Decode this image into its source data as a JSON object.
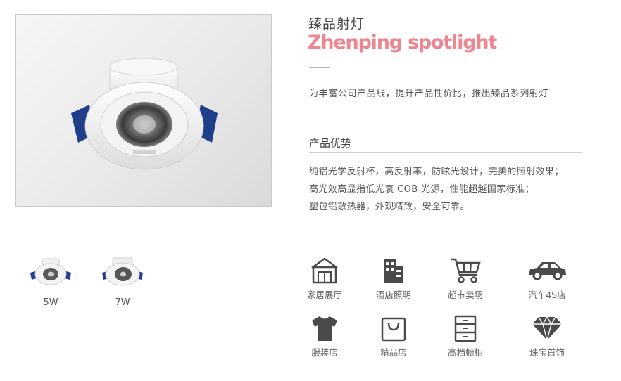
{
  "product": {
    "title_cn": "臻品射灯",
    "title_en": "Zhenping spotlight",
    "intro": "为丰富公司产品线，提升产品性价比，推出臻品系列射灯"
  },
  "advantages": {
    "title": "产品优势",
    "lines": [
      "纯铝光学反射杯，高反射率，防眩光设计，完美的照射效果；",
      "高光效高显指低光衰 COB 光源，性能超越国家标准；",
      "塑包铝散热器，外观精致，安全可靠。"
    ]
  },
  "variants": [
    {
      "label": "5W"
    },
    {
      "label": "7W"
    }
  ],
  "scenes": [
    {
      "label": "家居展厅",
      "icon": "house-icon"
    },
    {
      "label": "酒店照明",
      "icon": "hotel-icon"
    },
    {
      "label": "超市卖场",
      "icon": "shopping-cart-icon"
    },
    {
      "label": "汽车4S店",
      "icon": "car-icon"
    },
    {
      "label": "服装店",
      "icon": "tshirt-icon"
    },
    {
      "label": "精品店",
      "icon": "shopping-bag-icon"
    },
    {
      "label": "高档橱柜",
      "icon": "cabinet-icon"
    },
    {
      "label": "珠宝首饰",
      "icon": "diamond-icon"
    }
  ],
  "colors": {
    "accent": "#ec8791",
    "icon": "#4a4a4a",
    "clip": "#1f3f8a"
  }
}
